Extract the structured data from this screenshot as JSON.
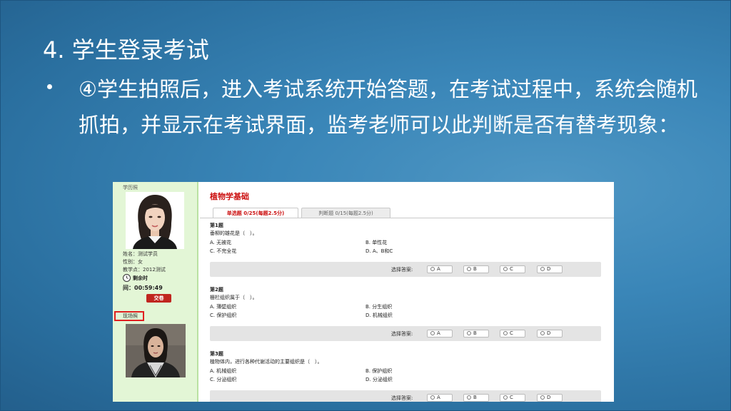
{
  "slide": {
    "title": "4. 学生登录考试",
    "bullet": "④学生拍照后，进入考试系统开始答题，在考试过程中，系统会随机抓拍，并显示在考试界面，监考老师可以此判断是否有替考现象："
  },
  "exam": {
    "left": {
      "id_photo_label": "学历照",
      "name": "姓名：测试学员",
      "gender": "性别：女",
      "site": "教学点：2012测试",
      "remaining_label": "剩余时",
      "remaining_time": "间：00:59:49",
      "submit_label": "交卷",
      "live_photo_label": "现场照"
    },
    "course_title": "植物学基础",
    "tabs": [
      {
        "label": "单选题 0/25(每题2.5分)"
      },
      {
        "label": "判断题 0/15(每题2.5分)"
      }
    ],
    "answer_label": "选择答案:",
    "choices": [
      "A",
      "B",
      "C",
      "D"
    ],
    "questions": [
      {
        "num": "第1题",
        "text": "垂柳的雄花是（　）。",
        "options": [
          "A. 无被花",
          "B. 单性花",
          "C. 不完全花",
          "D. A、B和C"
        ]
      },
      {
        "num": "第2题",
        "text": "栅栏组织属于（　）。",
        "options": [
          "A. 薄壁组织",
          "B. 分生组织",
          "C. 保护组织",
          "D. 机械组织"
        ]
      },
      {
        "num": "第3题",
        "text": "植物体内，进行各种代谢活动的主要组织是（　）。",
        "options": [
          "A. 机械组织",
          "B. 保护组织",
          "C. 分泌组织",
          "D. 分泌组织"
        ]
      }
    ]
  },
  "colors": {
    "accent_red": "#cc1111",
    "panel_green": "#e3f6d6",
    "submit_red": "#c0261f",
    "highlight_red": "#e02020"
  }
}
